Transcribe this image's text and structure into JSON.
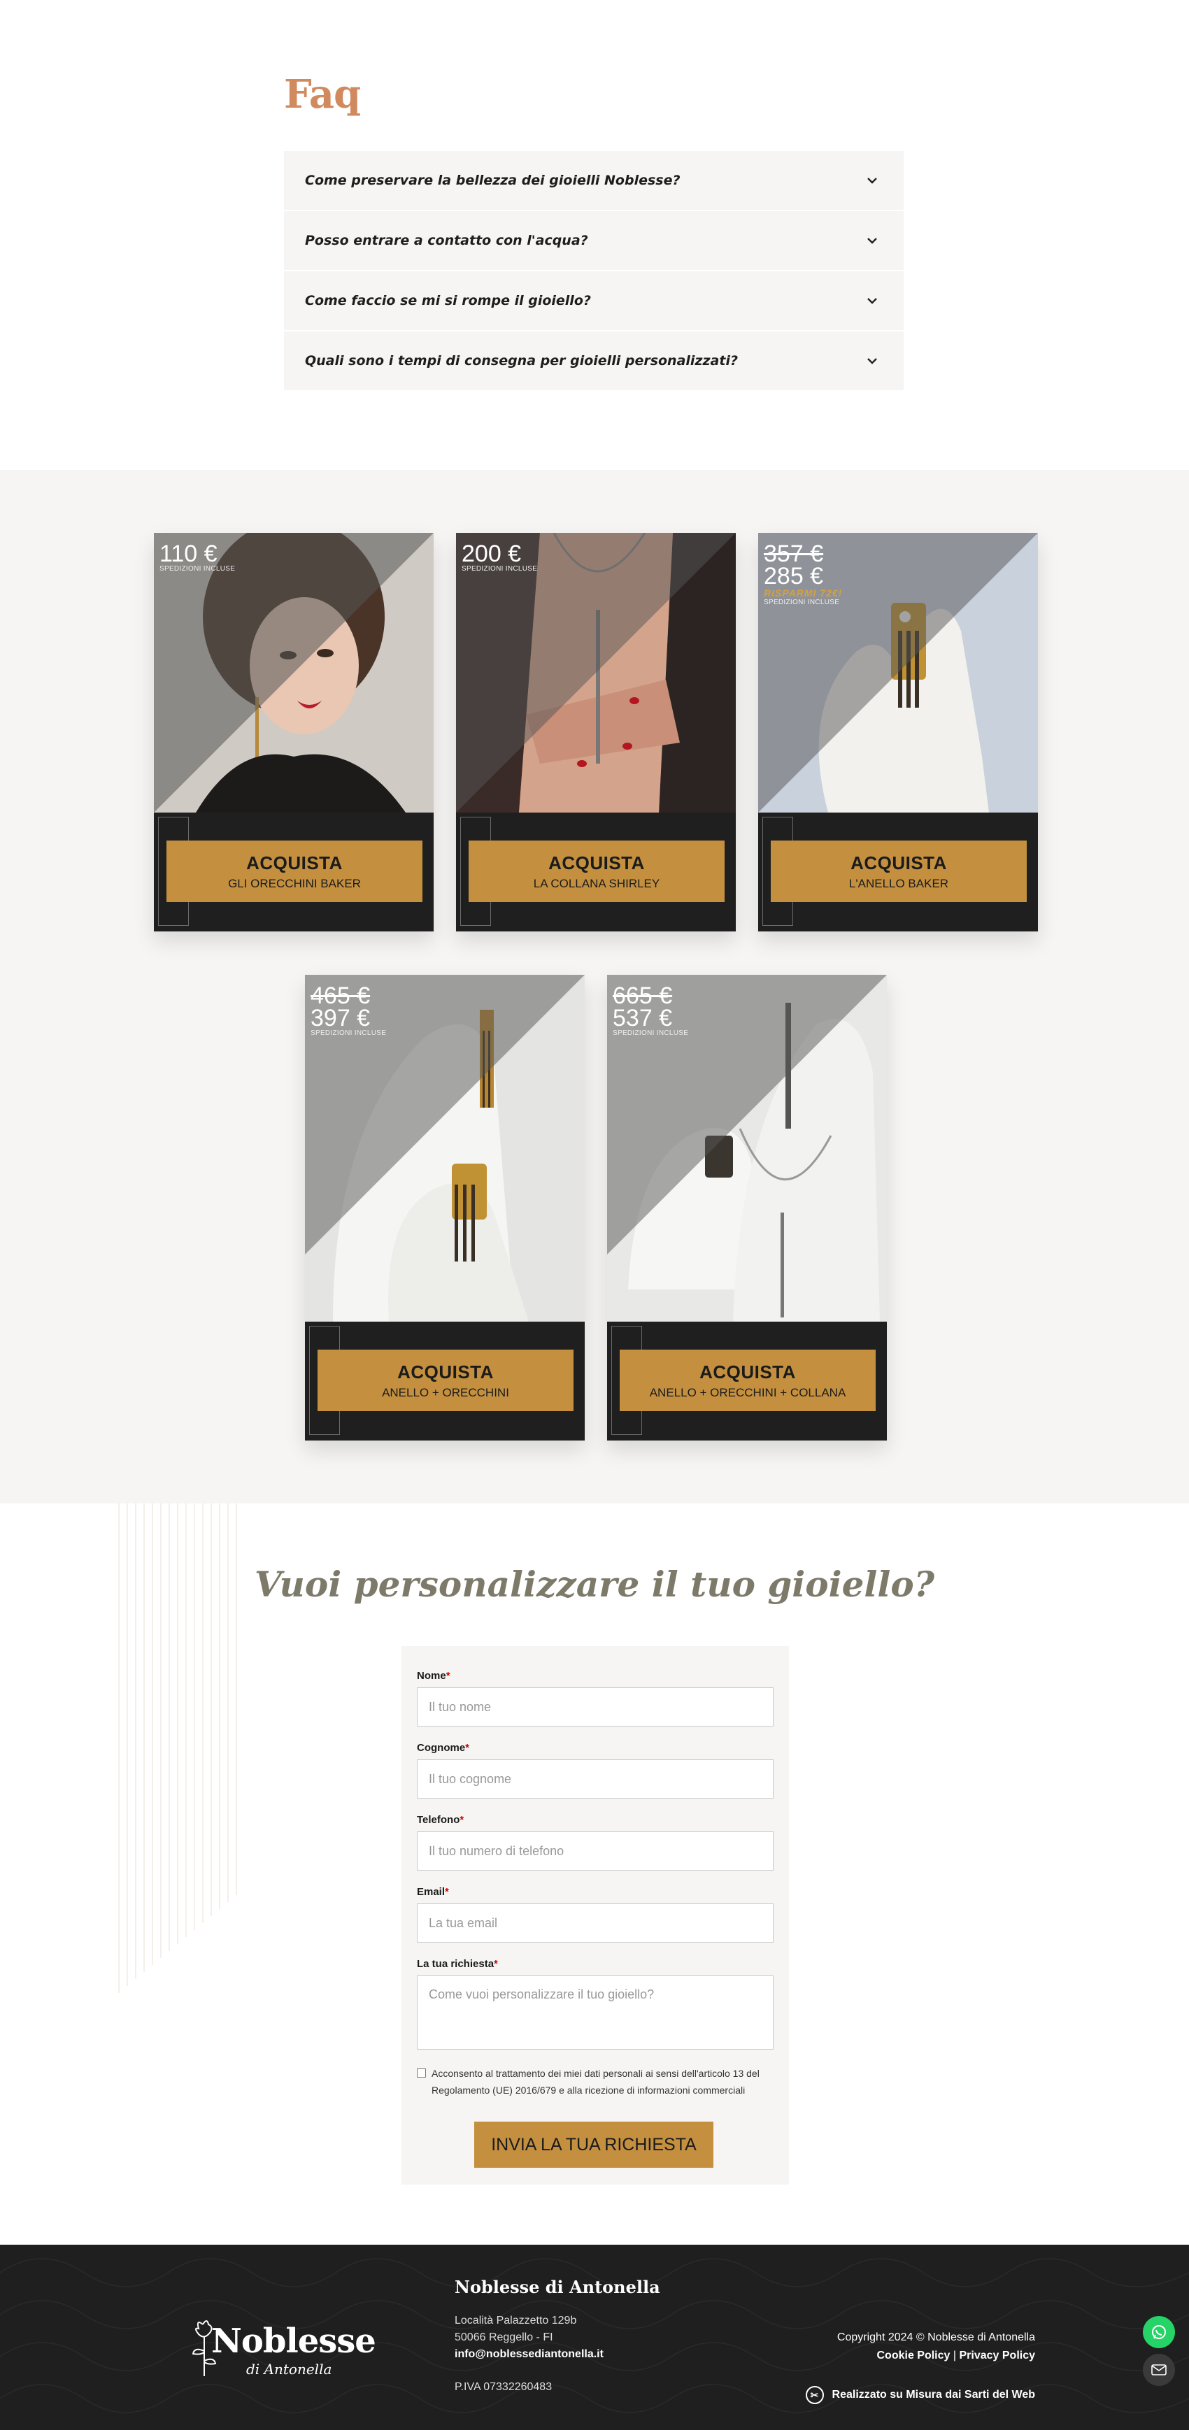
{
  "faq": {
    "title": "Faq",
    "items": [
      {
        "question": "Come preservare la bellezza dei gioielli Noblesse?"
      },
      {
        "question": "Posso entrare a contatto con l'acqua?"
      },
      {
        "question": "Come faccio se mi si rompe il gioiello?"
      },
      {
        "question": "Quali sono i tempi di consegna per gioielli personalizzati?"
      }
    ]
  },
  "products": [
    {
      "price": "110 €",
      "old_price": "",
      "savings": "",
      "shipping": "SPEDIZIONI INCLUSE",
      "button_top": "ACQUISTA",
      "button_bottom": "GLI ORECCHINI BAKER",
      "image": "woman-earrings-photo"
    },
    {
      "price": "200 €",
      "old_price": "",
      "savings": "",
      "shipping": "SPEDIZIONI INCLUSE",
      "button_top": "ACQUISTA",
      "button_bottom": "LA COLLANA SHIRLEY",
      "image": "necklace-photo"
    },
    {
      "price": "285 €",
      "old_price": "357 €",
      "savings": "RISPARMI 72€!",
      "shipping": "SPEDIZIONI INCLUSE",
      "button_top": "ACQUISTA",
      "button_bottom": "L'ANELLO BAKER",
      "image": "ring-photo"
    },
    {
      "price": "397 €",
      "old_price": "465 €",
      "savings": "",
      "shipping": "SPEDIZIONI INCLUSE",
      "button_top": "ACQUISTA",
      "button_bottom": "ANELLO + ORECCHINI",
      "image": "ring-earrings-photo"
    },
    {
      "price": "537 €",
      "old_price": "665 €",
      "savings": "",
      "shipping": "SPEDIZIONI INCLUSE",
      "button_top": "ACQUISTA",
      "button_bottom": "ANELLO + ORECCHINI + COLLANA",
      "image": "set-photo"
    }
  ],
  "custom": {
    "title": "Vuoi personalizzare il tuo gioiello?",
    "fields": [
      {
        "label": "Nome",
        "placeholder": "Il tuo nome"
      },
      {
        "label": "Cognome",
        "placeholder": "Il tuo cognome"
      },
      {
        "label": "Telefono",
        "placeholder": "Il tuo numero di telefono"
      },
      {
        "label": "Email",
        "placeholder": "La tua email"
      },
      {
        "label": "La tua richiesta",
        "placeholder": "Come vuoi personalizzare il tuo gioiello?"
      }
    ],
    "required_mark": "*",
    "consent": "Acconsento al trattamento dei miei dati personali ai sensi dell'articolo 13 del Regolamento (UE) 2016/679 e alla ricezione di informazioni commerciali",
    "submit": "INVIA LA TUA RICHIESTA"
  },
  "footer": {
    "logo_text": "Noblesse",
    "logo_script": "di Antonella",
    "company": "Noblesse di Antonella",
    "address1": "Località Palazzetto 129b",
    "address2": "50066 Reggello - FI",
    "email": "info@noblessediantonella.it",
    "piva": "P.IVA 07332260483",
    "copyright": "Copyright 2024 © Noblesse di Antonella",
    "cookie": "Cookie Policy",
    "separator": "|",
    "privacy": "Privacy Policy",
    "credit": "Realizzato su Misura dai Sarti del Web"
  },
  "colors": {
    "accent": "#c4903f",
    "faq_title": "#d18a5e",
    "dark": "#1f1f1f",
    "bg_light": "#f6f5f3",
    "whatsapp": "#25d366"
  }
}
